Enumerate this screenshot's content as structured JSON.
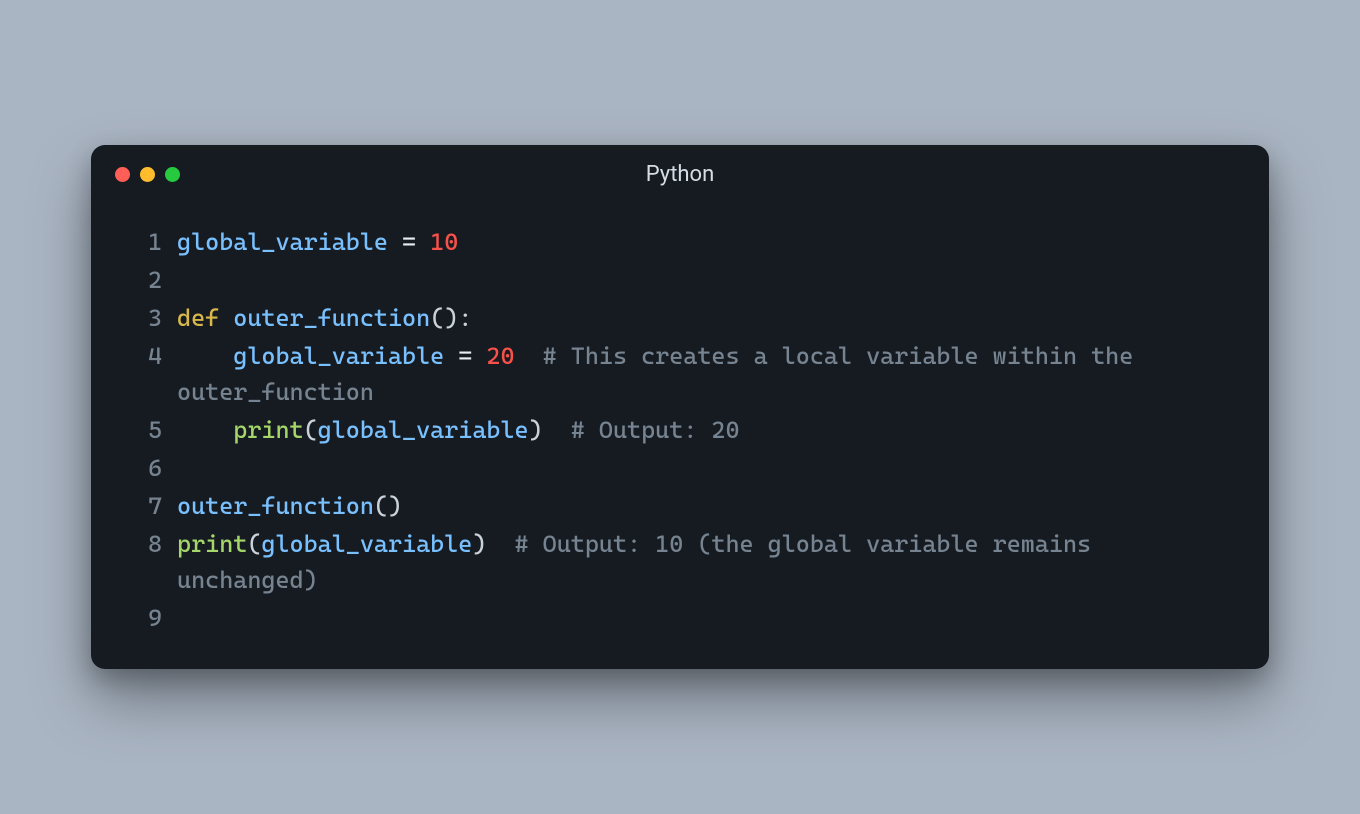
{
  "window": {
    "title": "Python"
  },
  "lines": {
    "n1": "1",
    "n2": "2",
    "n3": "3",
    "n4": "4",
    "n5": "5",
    "n6": "6",
    "n7": "7",
    "n8": "8",
    "n9": "9"
  },
  "t": {
    "global_variable": "global_variable",
    "eq": " = ",
    "ten": "10",
    "twenty": "20",
    "def": "def",
    "sp": " ",
    "outer_function": "outer_function",
    "lpar": "(",
    "rpar": ")",
    "colon": ":",
    "indent": "    ",
    "print": "print",
    "two_sp": "  ",
    "comment_local": "# This creates a local variable within the outer_function",
    "comment_out20": "# Output: 20",
    "comment_out10": "# Output: 10 (the global variable remains unchanged)"
  }
}
